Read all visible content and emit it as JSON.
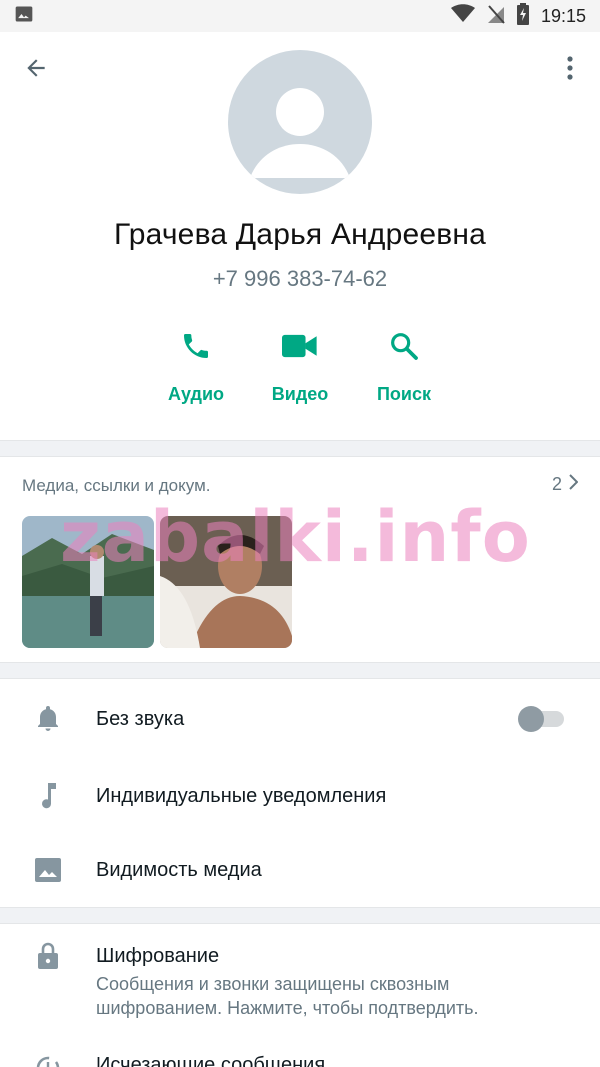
{
  "status_bar": {
    "time": "19:15",
    "icons": [
      "image-icon",
      "wifi-icon",
      "signal-off-icon",
      "battery-charging-icon"
    ]
  },
  "header": {
    "back_icon": "arrow-back-icon",
    "menu_icon": "more-vert-icon"
  },
  "contact": {
    "name": "Грачева Дарья Андреевна",
    "phone": "+7 996 383-74-62"
  },
  "actions": [
    {
      "label": "Аудио",
      "icon": "phone-icon"
    },
    {
      "label": "Видео",
      "icon": "videocam-icon"
    },
    {
      "label": "Поиск",
      "icon": "search-icon"
    }
  ],
  "media": {
    "header": "Медиа, ссылки и докум.",
    "count": "2",
    "watermark": "zabalki.info"
  },
  "settings": {
    "mute_label": "Без звука",
    "mute_enabled": false,
    "custom_notifications_label": "Индивидуальные уведомления",
    "media_visibility_label": "Видимость медиа",
    "encryption_label": "Шифрование",
    "encryption_sub": "Сообщения и звонки защищены сквозным шифрованием. Нажмите, чтобы подтвердить.",
    "disappearing_label": "Исчезающие сообщения"
  },
  "colors": {
    "accent": "#00a884",
    "text_secondary": "#667781",
    "icon_gray": "#8696a0"
  }
}
